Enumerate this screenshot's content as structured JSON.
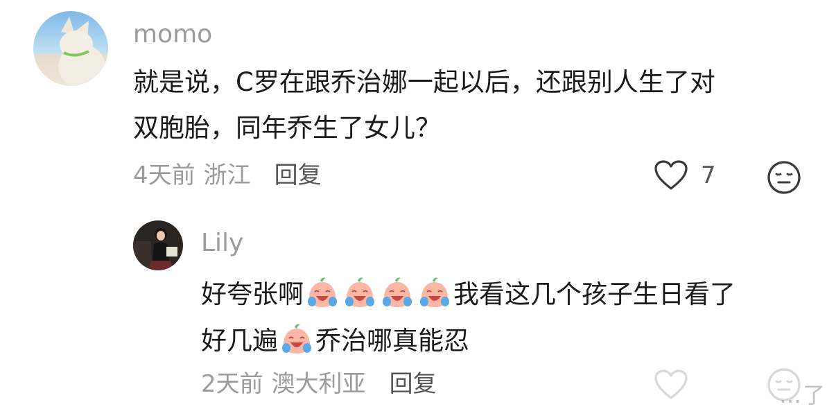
{
  "comment1": {
    "username": "momo",
    "lines": [
      "就是说，C罗在跟乔治娜一起以后，还跟别人生了对",
      "双胞胎，同年乔生了女儿？"
    ],
    "time": "4天前",
    "location": "浙江",
    "reply_label": "回复",
    "like_count": "7",
    "like_icon": "heart-outline-icon",
    "dislike_icon": "meh-face-icon"
  },
  "comment2": {
    "username": "Lily",
    "line1_before": "好夸张啊",
    "line1_after": "我看这几个孩子生日看了",
    "line2_before": "好几遍",
    "line2_after": "乔治哪真能忍",
    "emoji_icon": "crying-laughing-peach-emoji",
    "time": "2天前",
    "location": "澳大利亚",
    "reply_label": "回复",
    "like_icon": "heart-outline-icon",
    "dislike_icon": "meh-face-icon"
  },
  "watermark": "…了"
}
